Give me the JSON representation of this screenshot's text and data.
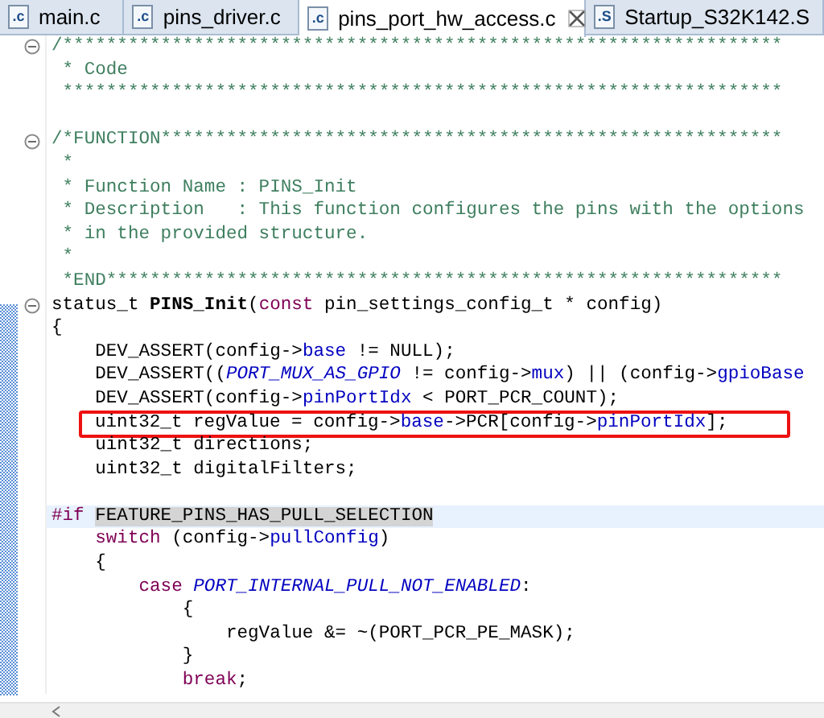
{
  "tabs": [
    {
      "label": "main.c",
      "icon_text": ".c",
      "selected": false,
      "closable": false
    },
    {
      "label": "pins_driver.c",
      "icon_text": ".c",
      "selected": false,
      "closable": false
    },
    {
      "label": "pins_port_hw_access.c",
      "icon_text": ".c",
      "selected": true,
      "closable": true
    },
    {
      "label": "Startup_S32K142.S",
      "icon_text": ".S",
      "selected": false,
      "closable": false
    }
  ],
  "lines": [
    {
      "fold": true,
      "current": false,
      "boxed": false,
      "tokens": [
        {
          "kind": "comment",
          "text": "/******************************************************************"
        }
      ]
    },
    {
      "fold": false,
      "current": false,
      "boxed": false,
      "tokens": [
        {
          "kind": "comment",
          "text": " * Code"
        }
      ]
    },
    {
      "fold": false,
      "current": false,
      "boxed": false,
      "tokens": [
        {
          "kind": "comment",
          "text": " ******************************************************************"
        }
      ]
    },
    {
      "fold": false,
      "current": false,
      "boxed": false
    },
    {
      "fold": true,
      "current": false,
      "boxed": false,
      "tokens": [
        {
          "kind": "comment",
          "text": "/*FUNCTION*********************************************************"
        }
      ]
    },
    {
      "fold": false,
      "current": false,
      "boxed": false,
      "tokens": [
        {
          "kind": "comment",
          "text": " *"
        }
      ]
    },
    {
      "fold": false,
      "current": false,
      "boxed": false,
      "tokens": [
        {
          "kind": "comment",
          "text": " * Function Name : PINS_Init"
        }
      ]
    },
    {
      "fold": false,
      "current": false,
      "boxed": false,
      "tokens": [
        {
          "kind": "comment",
          "text": " * Description   : This function configures the pins with the options"
        }
      ]
    },
    {
      "fold": false,
      "current": false,
      "boxed": false,
      "tokens": [
        {
          "kind": "comment",
          "text": " * in the provided structure."
        }
      ]
    },
    {
      "fold": false,
      "current": false,
      "boxed": false,
      "tokens": [
        {
          "kind": "comment",
          "text": " *"
        }
      ]
    },
    {
      "fold": false,
      "current": false,
      "boxed": false,
      "tokens": [
        {
          "kind": "comment",
          "text": " *END**************************************************************"
        }
      ]
    },
    {
      "fold": true,
      "current": false,
      "boxed": false,
      "tokens": [
        {
          "kind": "plain",
          "text": "status_t "
        },
        {
          "kind": "function",
          "text": "PINS_Init"
        },
        {
          "kind": "plain",
          "text": "("
        },
        {
          "kind": "keyword",
          "text": "const"
        },
        {
          "kind": "plain",
          "text": " pin_settings_config_t * config)"
        }
      ]
    },
    {
      "fold": false,
      "current": false,
      "boxed": false,
      "tokens": [
        {
          "kind": "plain",
          "text": "{"
        }
      ]
    },
    {
      "fold": false,
      "current": false,
      "boxed": false,
      "tokens": [
        {
          "kind": "plain",
          "text": "    DEV_ASSERT(config->"
        },
        {
          "kind": "field",
          "text": "base"
        },
        {
          "kind": "plain",
          "text": " != NULL);"
        }
      ]
    },
    {
      "fold": false,
      "current": false,
      "boxed": false,
      "tokens": [
        {
          "kind": "plain",
          "text": "    DEV_ASSERT(("
        },
        {
          "kind": "macro",
          "text": "PORT_MUX_AS_GPIO"
        },
        {
          "kind": "plain",
          "text": " != config->"
        },
        {
          "kind": "field",
          "text": "mux"
        },
        {
          "kind": "plain",
          "text": ") || (config->"
        },
        {
          "kind": "field",
          "text": "gpioBase"
        }
      ]
    },
    {
      "fold": false,
      "current": false,
      "boxed": false,
      "tokens": [
        {
          "kind": "plain",
          "text": "    DEV_ASSERT(config->"
        },
        {
          "kind": "field",
          "text": "pinPortIdx"
        },
        {
          "kind": "plain",
          "text": " < PORT_PCR_COUNT);"
        }
      ]
    },
    {
      "fold": false,
      "current": false,
      "boxed": true,
      "tokens": [
        {
          "kind": "plain",
          "text": "uint32_t regValue = config->"
        },
        {
          "kind": "field",
          "text": "base"
        },
        {
          "kind": "plain",
          "text": "->PCR[config->"
        },
        {
          "kind": "field",
          "text": "pinPortIdx"
        },
        {
          "kind": "plain",
          "text": "];"
        }
      ]
    },
    {
      "fold": false,
      "current": false,
      "boxed": false,
      "tokens": [
        {
          "kind": "plain",
          "text": "    uint32_t directions;"
        }
      ]
    },
    {
      "fold": false,
      "current": false,
      "boxed": false,
      "tokens": [
        {
          "kind": "plain",
          "text": "    uint32_t digitalFilters;"
        }
      ]
    },
    {
      "fold": false,
      "current": false,
      "boxed": false
    },
    {
      "fold": false,
      "current": true,
      "boxed": false,
      "tokens": [
        {
          "kind": "keyword",
          "text": "#if "
        },
        {
          "kind": "marked",
          "text": "FEATURE_PINS_HAS_PULL_SELECTION"
        }
      ]
    },
    {
      "fold": false,
      "current": false,
      "boxed": false,
      "tokens": [
        {
          "kind": "keyword",
          "text": "    switch"
        },
        {
          "kind": "plain",
          "text": " (config->"
        },
        {
          "kind": "field",
          "text": "pullConfig"
        },
        {
          "kind": "plain",
          "text": ")"
        }
      ]
    },
    {
      "fold": false,
      "current": false,
      "boxed": false,
      "tokens": [
        {
          "kind": "plain",
          "text": "    {"
        }
      ]
    },
    {
      "fold": false,
      "current": false,
      "boxed": false,
      "tokens": [
        {
          "kind": "keyword",
          "text": "        case "
        },
        {
          "kind": "macro",
          "text": "PORT_INTERNAL_PULL_NOT_ENABLED"
        },
        {
          "kind": "plain",
          "text": ":"
        }
      ]
    },
    {
      "fold": false,
      "current": false,
      "boxed": false,
      "tokens": [
        {
          "kind": "plain",
          "text": "            {"
        }
      ]
    },
    {
      "fold": false,
      "current": false,
      "boxed": false,
      "tokens": [
        {
          "kind": "plain",
          "text": "                regValue &= ~(PORT_PCR_PE_MASK);"
        }
      ]
    },
    {
      "fold": false,
      "current": false,
      "boxed": false,
      "tokens": [
        {
          "kind": "plain",
          "text": "            }"
        }
      ]
    },
    {
      "fold": false,
      "current": false,
      "boxed": false,
      "tokens": [
        {
          "kind": "keyword",
          "text": "            break"
        },
        {
          "kind": "plain",
          "text": ";"
        }
      ]
    }
  ]
}
